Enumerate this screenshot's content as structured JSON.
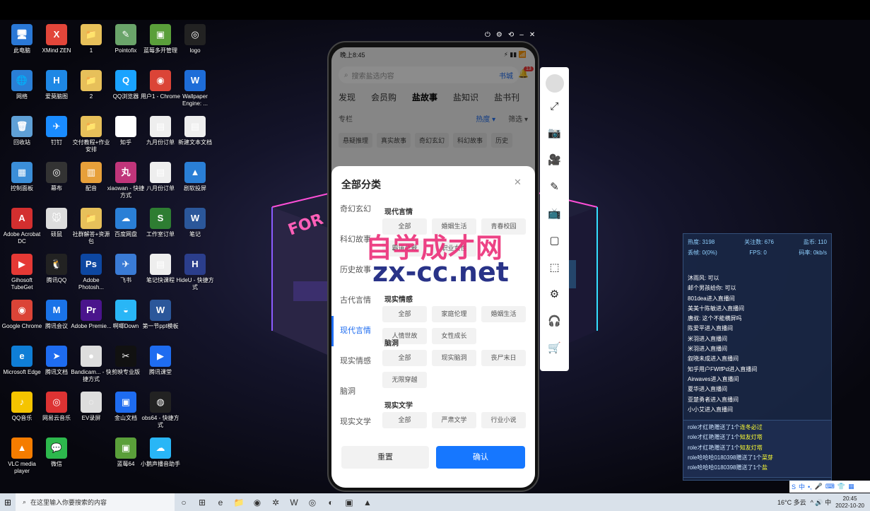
{
  "desktop": {
    "icons": [
      {
        "label": "此电脑",
        "col": 0,
        "row": 0,
        "color": "#2a78d6",
        "glyph": "🖥"
      },
      {
        "label": "XMind ZEN",
        "col": 1,
        "row": 0,
        "color": "#e2463a",
        "glyph": "X"
      },
      {
        "label": "1",
        "col": 2,
        "row": 0,
        "color": "#e7c05a",
        "glyph": "📁"
      },
      {
        "label": "Pointofix",
        "col": 3,
        "row": 0,
        "color": "#6aa46a",
        "glyph": "✎"
      },
      {
        "label": "蓝莓多开管理",
        "col": 4,
        "row": 0,
        "color": "#5a9f3a",
        "glyph": "▣"
      },
      {
        "label": "logo",
        "col": 5,
        "row": 0,
        "color": "#222",
        "glyph": "◎"
      },
      {
        "label": "网络",
        "col": 0,
        "row": 1,
        "color": "#2a7fd6",
        "glyph": "🌐"
      },
      {
        "label": "爱莫脑图",
        "col": 1,
        "row": 1,
        "color": "#1e88e5",
        "glyph": "H"
      },
      {
        "label": "2",
        "col": 2,
        "row": 1,
        "color": "#e7c05a",
        "glyph": "📁"
      },
      {
        "label": "QQ浏览器",
        "col": 3,
        "row": 1,
        "color": "#1aa3ff",
        "glyph": "Q"
      },
      {
        "label": "用户1 - Chrome",
        "col": 4,
        "row": 1,
        "color": "#db4437",
        "glyph": "◉"
      },
      {
        "label": "Wallpaper Engine: ...",
        "col": 5,
        "row": 1,
        "color": "#1e6dd8",
        "glyph": "W"
      },
      {
        "label": "回收站",
        "col": 0,
        "row": 2,
        "color": "#5fa0d6",
        "glyph": "🗑"
      },
      {
        "label": "钉钉",
        "col": 1,
        "row": 2,
        "color": "#1a8cff",
        "glyph": "✈"
      },
      {
        "label": "交付教程+作业安排",
        "col": 2,
        "row": 2,
        "color": "#e7c05a",
        "glyph": "📁"
      },
      {
        "label": "知乎",
        "col": 3,
        "row": 2,
        "color": "#fff",
        "glyph": "知"
      },
      {
        "label": "九月份订单",
        "col": 4,
        "row": 2,
        "color": "#eee",
        "glyph": "▤"
      },
      {
        "label": "新建文本文档",
        "col": 5,
        "row": 2,
        "color": "#eee",
        "glyph": "▤"
      },
      {
        "label": "控制面板",
        "col": 0,
        "row": 3,
        "color": "#3b8ed8",
        "glyph": "▦"
      },
      {
        "label": "幕布",
        "col": 1,
        "row": 3,
        "color": "#333",
        "glyph": "◎"
      },
      {
        "label": "配音",
        "col": 2,
        "row": 3,
        "color": "#e7a03a",
        "glyph": "▥"
      },
      {
        "label": "xiaowan - 快捷方式",
        "col": 3,
        "row": 3,
        "color": "#c0357a",
        "glyph": "丸"
      },
      {
        "label": "八月份订单",
        "col": 4,
        "row": 3,
        "color": "#eee",
        "glyph": "▤"
      },
      {
        "label": "剧软投屏",
        "col": 5,
        "row": 3,
        "color": "#2a7fd6",
        "glyph": "▲"
      },
      {
        "label": "Adobe Acrobat DC",
        "col": 0,
        "row": 4,
        "color": "#d32f2f",
        "glyph": "A"
      },
      {
        "label": "硕鼠",
        "col": 1,
        "row": 4,
        "color": "#ddd",
        "glyph": "🐭"
      },
      {
        "label": "社群解答+资源包",
        "col": 2,
        "row": 4,
        "color": "#e7c05a",
        "glyph": "📁"
      },
      {
        "label": "百度网盘",
        "col": 3,
        "row": 4,
        "color": "#2a7fd6",
        "glyph": "☁"
      },
      {
        "label": "工作室订单",
        "col": 4,
        "row": 4,
        "color": "#2e7d32",
        "glyph": "S"
      },
      {
        "label": "笔记",
        "col": 5,
        "row": 4,
        "color": "#2b579a",
        "glyph": "W"
      },
      {
        "label": "Gihosoft TubeGet",
        "col": 0,
        "row": 5,
        "color": "#e53935",
        "glyph": "▶"
      },
      {
        "label": "腾讯QQ",
        "col": 1,
        "row": 5,
        "color": "#222",
        "glyph": "🐧"
      },
      {
        "label": "Adobe Photosh...",
        "col": 2,
        "row": 5,
        "color": "#0d47a1",
        "glyph": "Ps"
      },
      {
        "label": "飞书",
        "col": 3,
        "row": 5,
        "color": "#3a7bd5",
        "glyph": "✈"
      },
      {
        "label": "笔记快课程",
        "col": 4,
        "row": 5,
        "color": "#eee",
        "glyph": "▤"
      },
      {
        "label": "HideU - 快捷方式",
        "col": 5,
        "row": 5,
        "color": "#2b3e8c",
        "glyph": "H"
      },
      {
        "label": "Google Chrome",
        "col": 0,
        "row": 6,
        "color": "#db4437",
        "glyph": "◉"
      },
      {
        "label": "腾讯会议",
        "col": 1,
        "row": 6,
        "color": "#1a73e8",
        "glyph": "M"
      },
      {
        "label": "Adobe Premie...",
        "col": 2,
        "row": 6,
        "color": "#4a148c",
        "glyph": "Pr"
      },
      {
        "label": "啊唧Down",
        "col": 3,
        "row": 6,
        "color": "#29b6f6",
        "glyph": "◒"
      },
      {
        "label": "第一节ppt模板",
        "col": 4,
        "row": 6,
        "color": "#2b579a",
        "glyph": "W"
      },
      {
        "label": "Microsoft Edge",
        "col": 0,
        "row": 7,
        "color": "#0f7ed6",
        "glyph": "e"
      },
      {
        "label": "腾讯文档",
        "col": 1,
        "row": 7,
        "color": "#1e6cf0",
        "glyph": "➤"
      },
      {
        "label": "Bandicam... - 快捷方式",
        "col": 2,
        "row": 7,
        "color": "#ddd",
        "glyph": "●"
      },
      {
        "label": "剪映专业版",
        "col": 3,
        "row": 7,
        "color": "#111",
        "glyph": "✂"
      },
      {
        "label": "腾讯课堂",
        "col": 4,
        "row": 7,
        "color": "#1e6cf0",
        "glyph": "▶"
      },
      {
        "label": "QQ音乐",
        "col": 0,
        "row": 8,
        "color": "#f5c400",
        "glyph": "♪"
      },
      {
        "label": "网易云音乐",
        "col": 1,
        "row": 8,
        "color": "#d33",
        "glyph": "◎"
      },
      {
        "label": "EV录屏",
        "col": 2,
        "row": 8,
        "color": "#ddd",
        "glyph": "◌"
      },
      {
        "label": "金山文档",
        "col": 3,
        "row": 8,
        "color": "#1e6cf0",
        "glyph": "▣"
      },
      {
        "label": "obs64 - 快捷方式",
        "col": 4,
        "row": 8,
        "color": "#222",
        "glyph": "◍"
      },
      {
        "label": "VLC media player",
        "col": 0,
        "row": 9,
        "color": "#f57c00",
        "glyph": "▲"
      },
      {
        "label": "微信",
        "col": 1,
        "row": 9,
        "color": "#2db84d",
        "glyph": "💬"
      },
      {
        "label": "蓝莓64",
        "col": 3,
        "row": 9,
        "color": "#5a9f3a",
        "glyph": "▣"
      },
      {
        "label": "小鹅声播音助手",
        "col": 4,
        "row": 9,
        "color": "#29b6f6",
        "glyph": "☁"
      }
    ]
  },
  "window_controls": [
    "⏻",
    "⚙",
    "⟲",
    "–",
    "✕"
  ],
  "phone": {
    "status_time": "晚上8:45",
    "status_icons": "⚡ ▮▮ 📶",
    "search_placeholder": "搜索盐选内容",
    "bookshelf": "书城",
    "badge": "13",
    "tabs": [
      "发现",
      "会员购",
      "盐故事",
      "盐知识",
      "盐书刊"
    ],
    "active_tab": "盐故事",
    "column_label": "专栏",
    "sort_label": "热度 ▾",
    "filter_label": "筛选 ▾",
    "chips": [
      "悬疑推理",
      "真实故事",
      "奇幻玄幻",
      "科幻故事",
      "历史"
    ],
    "sheet": {
      "title": "全部分类",
      "close": "✕",
      "categories": [
        "奇幻玄幻",
        "科幻故事",
        "历史故事",
        "古代言情",
        "现代言情",
        "现实情感",
        "脑洞",
        "现实文学"
      ],
      "active_category": "现代言情",
      "groups": [
        {
          "title": "现代言情",
          "options": [
            "全部",
            "婚姻生活",
            "青春校园",
            "霸道总裁",
            "职业女性"
          ]
        },
        {
          "title": "现实情感",
          "options": [
            "全部",
            "家庭伦理",
            "婚姻生活",
            "人情世故",
            "女性成长"
          ]
        },
        {
          "title": "脑洞",
          "options": [
            "全部",
            "现实脑洞",
            "丧尸末日",
            "无限穿越"
          ]
        },
        {
          "title": "现实文学",
          "options": [
            "全部",
            "严肃文学",
            "行业小说"
          ]
        }
      ],
      "reset": "重置",
      "confirm": "确认"
    }
  },
  "watermark": {
    "line1": "自学成才网",
    "line2": "zx-cc.net"
  },
  "sidebar_tools": [
    "⤢",
    "📷",
    "🎥",
    "✎",
    "📺",
    "▢",
    "⬚",
    "⚙",
    "🎧",
    "🛒"
  ],
  "stats": {
    "hot_label": "热度: 3198",
    "follow_label": "关注数: 676",
    "salt_label": "盐币: 110",
    "drop_label": "丢帧: 0(0%)",
    "fps_label": "FPS: 0",
    "bitrate_label": "码率: 0kb/s"
  },
  "chat": [
    "沐雨风: 可以",
    "邮个男孩给你: 可以",
    "801dea进入直播间",
    "美美十陈敏进入直播间",
    "唐叔: 这个不能横屏吗",
    "陈爱平进入直播间",
    "米羽进入直播间",
    "米羽进入直播间",
    "叙晓未成进入直播间",
    "知乎用户FWlfPd进入直播间",
    "Airwaves进入直播间",
    "夏华进入直播间",
    "亚楚勇者进入直播间",
    "小小艾进入直播间"
  ],
  "gifts": [
    {
      "who": "role才红艳",
      "what": "赠送了1个",
      "item": "连冬必过"
    },
    {
      "who": "role才红艳",
      "what": "赠送了1个",
      "item": "知友灯塔"
    },
    {
      "who": "role才红艳",
      "what": "赠送了1个",
      "item": "知友灯塔"
    },
    {
      "who": "role哈哈哈0180398",
      "what": "赠送了1个",
      "item": "菜芽"
    },
    {
      "who": "role哈哈哈0180398",
      "what": "赠送了1个",
      "item": "盐"
    }
  ],
  "ime": [
    "S",
    "中",
    "•,",
    "🎤",
    "⌨",
    "👕",
    "▦"
  ],
  "taskbar": {
    "search_placeholder": "在这里输入你要搜索的内容",
    "apps": [
      "○",
      "⊞",
      "e",
      "📁",
      "◉",
      "✲",
      "W",
      "◎",
      "◐",
      "▣",
      "▲"
    ],
    "weather": "16°C 多云",
    "tray_icons": "^ 🔊 中",
    "time": "20:45",
    "date": "2022-10-20"
  }
}
